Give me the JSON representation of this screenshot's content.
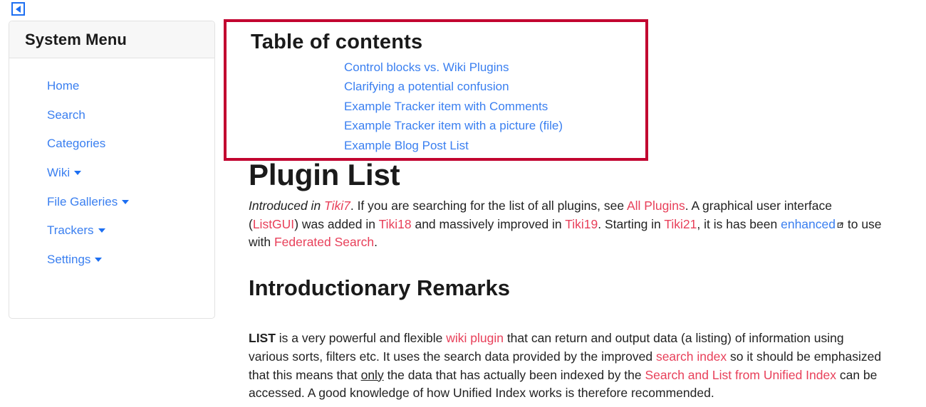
{
  "colors": {
    "link_blue": "#3a7ff0",
    "link_red": "#e8405a",
    "toc_border": "#c20430",
    "sidebar_header_bg": "#f7f7f7",
    "text": "#222222"
  },
  "toggle": {
    "icon": "caret-left-icon",
    "label": "Collapse side menu"
  },
  "sidebar": {
    "title": "System Menu",
    "items": [
      {
        "label": "Home",
        "has_caret": false
      },
      {
        "label": "Search",
        "has_caret": false
      },
      {
        "label": "Categories",
        "has_caret": false
      },
      {
        "label": "Wiki",
        "has_caret": true
      },
      {
        "label": "File Galleries",
        "has_caret": true
      },
      {
        "label": "Trackers",
        "has_caret": true
      },
      {
        "label": "Settings",
        "has_caret": true
      }
    ]
  },
  "toc": {
    "title": "Table of contents",
    "links": [
      "Control blocks vs. Wiki Plugins",
      "Clarifying a potential confusion",
      "Example Tracker item with Comments",
      "Example Tracker item with a picture (file)",
      "Example Blog Post List"
    ]
  },
  "main": {
    "page_title": "Plugin List",
    "intro": {
      "t1": "Introduced in ",
      "l_tiki7": "Tiki7",
      "t2": ". If you are searching for the list of all plugins, see ",
      "l_all_plugins": "All Plugins",
      "t3": ". A graphical user interface (",
      "l_listgui": "ListGUI",
      "t4": ") was added in ",
      "l_tiki18": "Tiki18",
      "t5": " and massively improved in ",
      "l_tiki19": "Tiki19",
      "t6": ". Starting in ",
      "l_tiki21": "Tiki21",
      "t7": ", it is has been ",
      "l_enhanced": "enhanced",
      "ext_icon": "external-link-icon",
      "t8": " to use with ",
      "l_federated": "Federated Search",
      "t9": "."
    },
    "section_title": "Introductionary Remarks",
    "remarks": {
      "b_list": "LIST",
      "t1": " is a very powerful and flexible ",
      "l_wiki_plugin": "wiki plugin",
      "t2": " that can return and output data (a listing) of information using various sorts, filters etc. It uses the search data provided by the improved ",
      "l_search_index": "search index",
      "t3": " so it should be emphasized that this means that ",
      "u_only": "only",
      "t4": " the data that has actually been indexed by the ",
      "l_salfui": "Search and List from Unified Index",
      "t5": " can be accessed. A good knowledge of how Unified Index works is therefore recommended."
    }
  }
}
